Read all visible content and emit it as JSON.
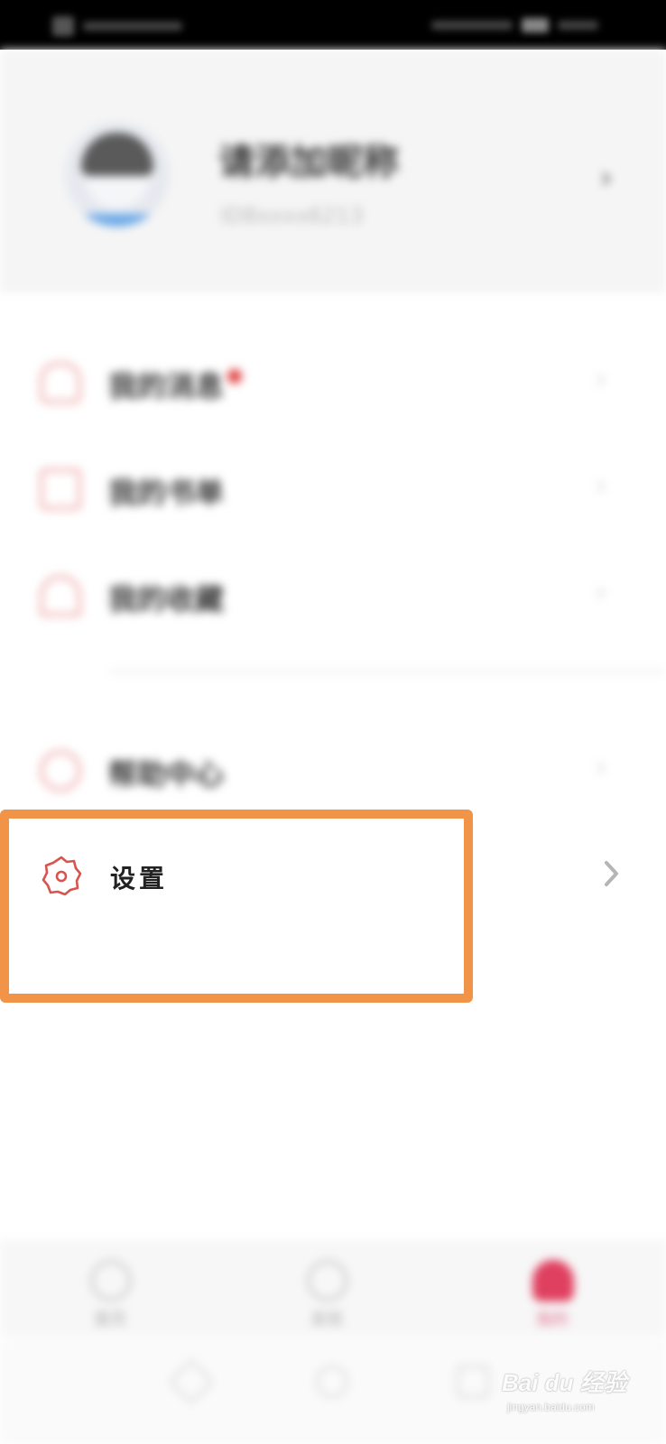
{
  "profile": {
    "name": "请添加昵称",
    "id_text": "ID8xxxx6213"
  },
  "menu": {
    "items": [
      {
        "label": "我的消息",
        "has_dot": true
      },
      {
        "label": "我的书单"
      },
      {
        "label": "我的收藏"
      }
    ],
    "help": {
      "label": "帮助中心"
    },
    "settings": {
      "label": "设置"
    }
  },
  "bottom_nav": {
    "items": [
      {
        "label": "首页"
      },
      {
        "label": "发现"
      },
      {
        "label": "我的"
      }
    ]
  },
  "colors": {
    "highlight": "#f29448",
    "accent": "#e04060",
    "settings_icon": "#d9534f"
  },
  "watermark": {
    "logo": "Bai du 经验",
    "url": "jingyan.baidu.com"
  }
}
